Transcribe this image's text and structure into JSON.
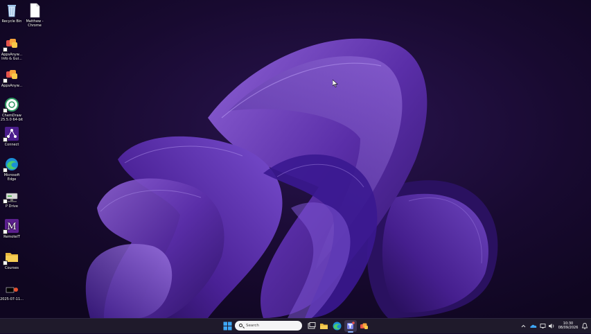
{
  "desktop": {
    "icons": [
      {
        "name": "recycle-bin",
        "label": "Recycle Bin"
      },
      {
        "name": "matthew-chrome",
        "label": "Matthew - Chrome"
      },
      {
        "name": "appsanywhere-info",
        "label": "AppsAnyw... Info & Gui..."
      },
      {
        "name": "appsanywhere",
        "label": "AppsAnyw..."
      },
      {
        "name": "chemdraw",
        "label": "ChemDraw 25.5.0 64-bit"
      },
      {
        "name": "connect",
        "label": "Connect"
      },
      {
        "name": "microsoft-edge",
        "label": "Microsoft Edge"
      },
      {
        "name": "p-drive",
        "label": "P Drive"
      },
      {
        "name": "remotelt",
        "label": "RemoteIT"
      },
      {
        "name": "courses",
        "label": "Courses"
      },
      {
        "name": "file-2025",
        "label": "2025-07-11..."
      }
    ]
  },
  "taskbar": {
    "search_placeholder": "Search",
    "clock_time": "10:30",
    "clock_date": "08/09/2026"
  }
}
